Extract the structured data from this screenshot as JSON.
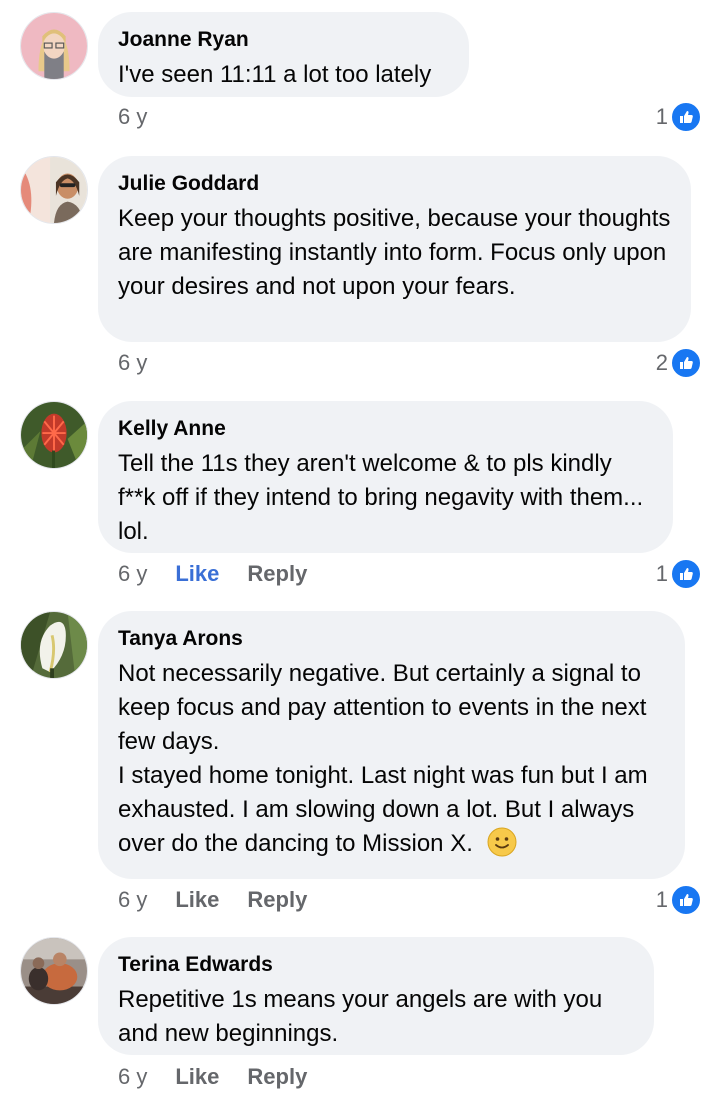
{
  "comments": [
    {
      "author": "Joanne Ryan",
      "text": "I've seen 11:11 a lot too lately",
      "time": "6 y",
      "like_label": "",
      "reply_label": "",
      "reaction_count": "1",
      "avatar_icon": "cartoon-avatar-icon"
    },
    {
      "author": "Julie Goddard",
      "text": "Keep your thoughts positive, because your thoughts are manifesting instantly into form. Focus only upon your desires and not upon your fears.",
      "time": "6 y",
      "like_label": "",
      "reply_label": "",
      "reaction_count": "2",
      "avatar_icon": "profile-photo-icon"
    },
    {
      "author": "Kelly Anne",
      "text": "Tell the 11s they aren't welcome & to pls kindly f**k off if they intend to bring negavity with them... lol.",
      "time": "6 y",
      "like_label": "Like",
      "reply_label": "Reply",
      "reaction_count": "1",
      "avatar_icon": "flower-photo-icon"
    },
    {
      "author": "Tanya Arons",
      "text": "Not necessarily negative.  But certainly a signal to keep focus and pay attention to events in the next few days.\nI stayed home tonight.  Last night was fun but I am exhausted.  I am slowing down a lot.  But I always over do the dancing to Mission X.",
      "time": "6 y",
      "like_label": "Like",
      "reply_label": "Reply",
      "reaction_count": "1",
      "avatar_icon": "lily-photo-icon"
    },
    {
      "author": "Terina Edwards",
      "text": "Repetitive 1s means your angels are with you and new beginnings.",
      "time": "6 y",
      "like_label": "Like",
      "reply_label": "Reply",
      "reaction_count": "",
      "avatar_icon": "people-photo-icon"
    }
  ],
  "colors": {
    "bubble_bg": "#f0f2f5",
    "meta_gray": "#65676b",
    "like_blue": "#1877f2",
    "like_active": "#3a6fd6"
  }
}
